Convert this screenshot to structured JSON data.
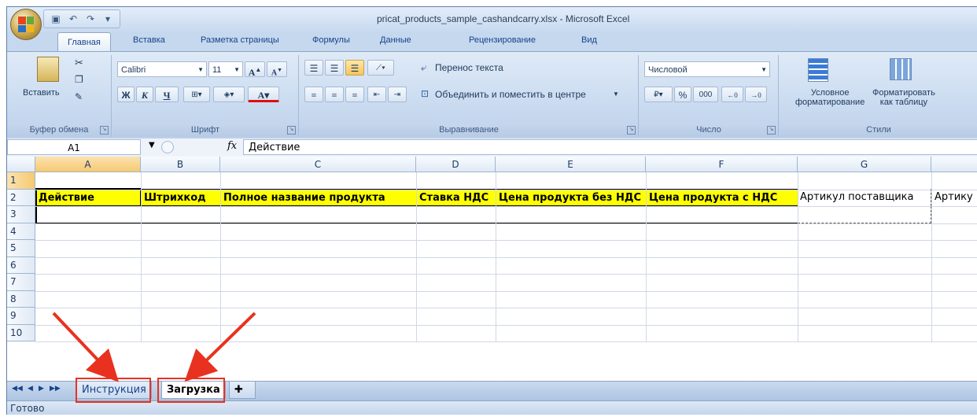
{
  "window": {
    "title": "pricat_products_sample_cashandcarry.xlsx - Microsoft Excel"
  },
  "ribbon_tabs": [
    "Главная",
    "Вставка",
    "Разметка страницы",
    "Формулы",
    "Данные",
    "Рецензирование",
    "Вид"
  ],
  "clipboard": {
    "paste_label": "Вставить",
    "group_label": "Буфер обмена"
  },
  "font": {
    "name": "Calibri",
    "size": "11",
    "bold": "Ж",
    "italic": "К",
    "underline": "Ч",
    "group_label": "Шрифт"
  },
  "alignment": {
    "wrap_text": "Перенос текста",
    "merge_center": "Объединить и поместить в центре",
    "group_label": "Выравнивание"
  },
  "number": {
    "format": "Числовой",
    "percent": "%",
    "thousands": "000",
    "group_label": "Число"
  },
  "styles": {
    "conditional": "Условное",
    "conditional2": "форматирование",
    "format_table": "Форматировать",
    "format_table2": "как таблицу",
    "group_label": "Стили"
  },
  "formula_bar": {
    "name_box": "A1",
    "fx": "fx",
    "content": "Действие"
  },
  "columns": [
    "A",
    "B",
    "C",
    "D",
    "E",
    "F",
    "G"
  ],
  "rows": [
    "1",
    "2",
    "3",
    "4",
    "5",
    "6",
    "7",
    "8",
    "9",
    "10"
  ],
  "row1": [
    "Действие",
    "Штрихкод",
    "Полное название продукта",
    "Ставка НДС",
    "Цена продукта без НДС",
    "Цена продукта с НДС",
    "Артикул поставщика",
    "Артику"
  ],
  "sheets": {
    "instr": "Инструкция",
    "load": "Загрузка"
  },
  "status": "Готово",
  "colors": {
    "highlight": "#ffff00",
    "annotation": "#e8321f"
  }
}
